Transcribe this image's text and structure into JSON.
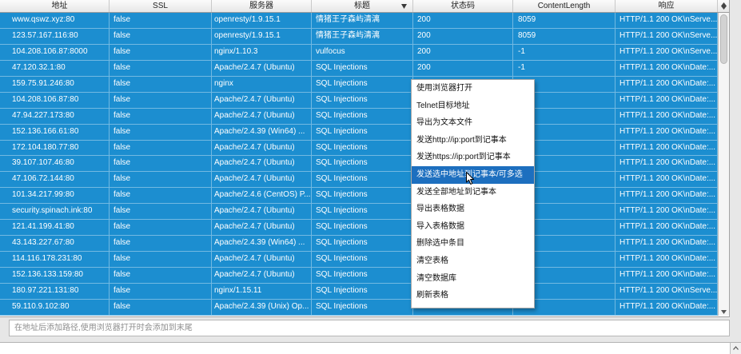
{
  "colors": {
    "row_selection": "#1c8ed0",
    "menu_highlight": "#1d6fbf"
  },
  "icons": {
    "sort": "sort-descending-icon",
    "column_control": "column-control-icon",
    "scroll_down": "scroll-down-arrow-icon",
    "scroll_up": "scroll-up-arrow-icon",
    "cursor": "mouse-cursor-icon"
  },
  "table": {
    "columns": [
      "地址",
      "SSL",
      "服务器",
      "标题",
      "状态码",
      "ContentLength",
      "响应"
    ],
    "sorted_column_index": 3,
    "all_rows_selected": true,
    "vertical_scroll": {
      "position": 0,
      "visible_fraction": 0.165
    },
    "rows": [
      {
        "address": "www.qswz.xyz:80",
        "ssl": "false",
        "server": "openresty/1.9.15.1",
        "title": "情猪王子森屿清漓",
        "status": "200",
        "content_length": "8059",
        "response": "HTTP/1.1 200 OK\\nServe..."
      },
      {
        "address": "123.57.167.116:80",
        "ssl": "false",
        "server": "openresty/1.9.15.1",
        "title": "情猪王子森屿清漓",
        "status": "200",
        "content_length": "8059",
        "response": "HTTP/1.1 200 OK\\nServe..."
      },
      {
        "address": "104.208.106.87:8000",
        "ssl": "false",
        "server": "nginx/1.10.3",
        "title": "vulfocus",
        "status": "200",
        "content_length": "-1",
        "response": "HTTP/1.1 200 OK\\nServe..."
      },
      {
        "address": "47.120.32.1:80",
        "ssl": "false",
        "server": "Apache/2.4.7 (Ubuntu)",
        "title": "SQL Injections",
        "status": "200",
        "content_length": "-1",
        "response": "HTTP/1.1 200 OK\\nDate:..."
      },
      {
        "address": "159.75.91.246:80",
        "ssl": "false",
        "server": "nginx",
        "title": "SQL Injections",
        "status": "",
        "content_length": "",
        "response": "HTTP/1.1 200 OK\\nDate:..."
      },
      {
        "address": "104.208.106.87:80",
        "ssl": "false",
        "server": "Apache/2.4.7 (Ubuntu)",
        "title": "SQL Injections",
        "status": "",
        "content_length": "",
        "response": "HTTP/1.1 200 OK\\nDate:..."
      },
      {
        "address": "47.94.227.173:80",
        "ssl": "false",
        "server": "Apache/2.4.7 (Ubuntu)",
        "title": "SQL Injections",
        "status": "",
        "content_length": "",
        "response": "HTTP/1.1 200 OK\\nDate:..."
      },
      {
        "address": "152.136.166.61:80",
        "ssl": "false",
        "server": "Apache/2.4.39 (Win64) ...",
        "title": "SQL Injections",
        "status": "",
        "content_length": "",
        "response": "HTTP/1.1 200 OK\\nDate:..."
      },
      {
        "address": "172.104.180.77:80",
        "ssl": "false",
        "server": "Apache/2.4.7 (Ubuntu)",
        "title": "SQL Injections",
        "status": "",
        "content_length": "",
        "response": "HTTP/1.1 200 OK\\nDate:..."
      },
      {
        "address": "39.107.107.46:80",
        "ssl": "false",
        "server": "Apache/2.4.7 (Ubuntu)",
        "title": "SQL Injections",
        "status": "",
        "content_length": "",
        "response": "HTTP/1.1 200 OK\\nDate:..."
      },
      {
        "address": "47.106.72.144:80",
        "ssl": "false",
        "server": "Apache/2.4.7 (Ubuntu)",
        "title": "SQL Injections",
        "status": "",
        "content_length": "",
        "response": "HTTP/1.1 200 OK\\nDate:..."
      },
      {
        "address": "101.34.217.99:80",
        "ssl": "false",
        "server": "Apache/2.4.6 (CentOS) P...",
        "title": "SQL Injections",
        "status": "",
        "content_length": "",
        "response": "HTTP/1.1 200 OK\\nDate:..."
      },
      {
        "address": "security.spinach.ink:80",
        "ssl": "false",
        "server": "Apache/2.4.7 (Ubuntu)",
        "title": "SQL Injections",
        "status": "",
        "content_length": "",
        "response": "HTTP/1.1 200 OK\\nDate:..."
      },
      {
        "address": "121.41.199.41:80",
        "ssl": "false",
        "server": "Apache/2.4.7 (Ubuntu)",
        "title": "SQL Injections",
        "status": "",
        "content_length": "",
        "response": "HTTP/1.1 200 OK\\nDate:..."
      },
      {
        "address": "43.143.227.67:80",
        "ssl": "false",
        "server": "Apache/2.4.39 (Win64) ...",
        "title": "SQL Injections",
        "status": "",
        "content_length": "",
        "response": "HTTP/1.1 200 OK\\nDate:..."
      },
      {
        "address": "114.116.178.231:80",
        "ssl": "false",
        "server": "Apache/2.4.7 (Ubuntu)",
        "title": "SQL Injections",
        "status": "",
        "content_length": "",
        "response": "HTTP/1.1 200 OK\\nDate:..."
      },
      {
        "address": "152.136.133.159:80",
        "ssl": "false",
        "server": "Apache/2.4.7 (Ubuntu)",
        "title": "SQL Injections",
        "status": "",
        "content_length": "",
        "response": "HTTP/1.1 200 OK\\nDate:..."
      },
      {
        "address": "180.97.221.131:80",
        "ssl": "false",
        "server": "nginx/1.15.11",
        "title": "SQL Injections",
        "status": "",
        "content_length": "",
        "response": "HTTP/1.1 200 OK\\nServe..."
      },
      {
        "address": "59.110.9.102:80",
        "ssl": "false",
        "server": "Apache/2.4.39 (Unix) Op...",
        "title": "SQL Injections",
        "status": "200",
        "content_length": "",
        "response": "HTTP/1.1 200 OK\\nDate:..."
      }
    ]
  },
  "context_menu": {
    "items": [
      {
        "label": "使用浏览器打开"
      },
      {
        "label": "Telnet目标地址"
      },
      {
        "label": "导出为文本文件"
      },
      {
        "label": "发送http://ip:port到记事本"
      },
      {
        "label": "发送https://ip:port到记事本"
      },
      {
        "label": "发送选中地址到记事本/可多选",
        "highlighted": true
      },
      {
        "label": "发送全部地址到记事本"
      },
      {
        "label": "导出表格数据"
      },
      {
        "label": "导入表格数据"
      },
      {
        "label": "删除选中条目"
      },
      {
        "label": "清空表格"
      },
      {
        "label": "清空数据库"
      },
      {
        "label": "刷新表格"
      }
    ]
  },
  "path_input": {
    "value": "",
    "placeholder": "在地址后添加路径,使用浏览器打开时会添加到末尾"
  }
}
